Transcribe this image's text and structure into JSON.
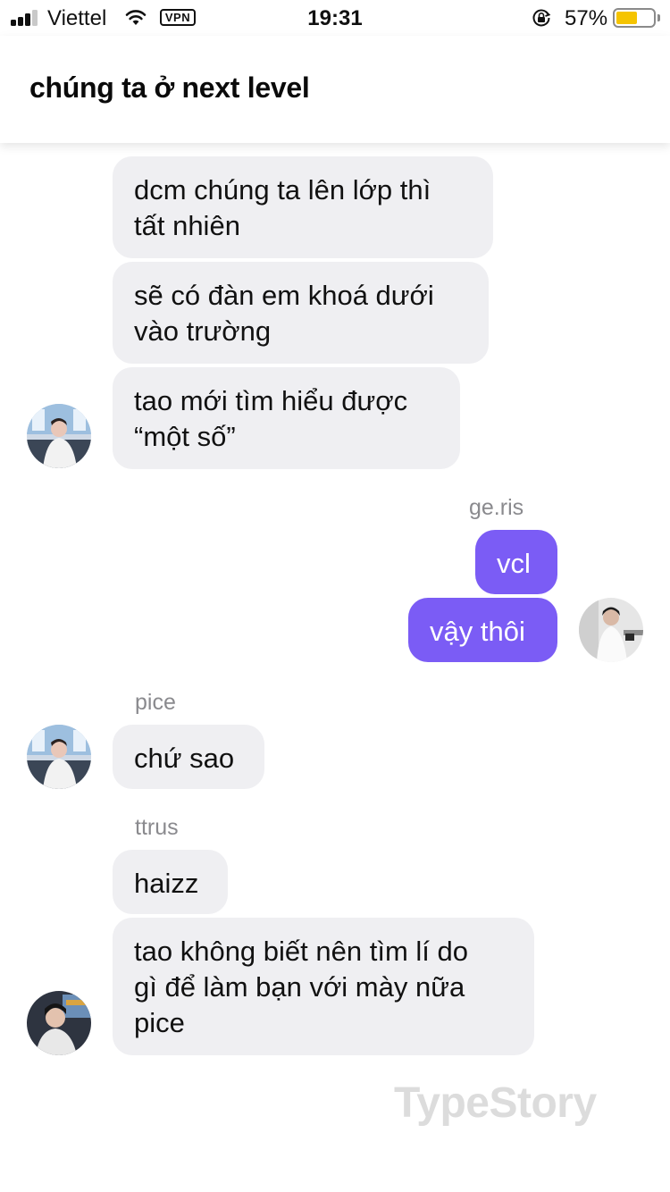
{
  "status_bar": {
    "carrier": "Viettel",
    "vpn": "VPN",
    "time": "19:31",
    "battery_percent_label": "57%",
    "battery_level": 0.57,
    "signal_bars": 3,
    "signal_bars_total": 4,
    "icons": [
      "signal-icon",
      "wifi-icon",
      "vpn-badge",
      "orientation-lock-icon",
      "battery-icon"
    ]
  },
  "header": {
    "title": "chúng ta ở next level"
  },
  "colors": {
    "outgoing_bubble": "#7b5cf5",
    "incoming_bubble": "#efeff2",
    "battery": "#f5c400"
  },
  "messages": {
    "m1_line1": "dcm chúng ta lên lớp thì",
    "m1_line2": "tất nhiên",
    "m2_line1": "sẽ có đàn em khoá dưới",
    "m2_line2": "vào trường",
    "m3_line1": "tao mới tìm hiểu được",
    "m3_line2": "“một số”",
    "sender_geris": "ge.ris",
    "m4": "vcl",
    "m5": "vậy thôi",
    "sender_pice": "pice",
    "m6": "chứ sao",
    "sender_ttrus": "ttrus",
    "m7": "haizz",
    "m8_line1": "tao không biết nên tìm lí do",
    "m8_line2": "gì để làm bạn với mày nữa",
    "m8_line3": "pice"
  },
  "watermark": "TypeStory"
}
